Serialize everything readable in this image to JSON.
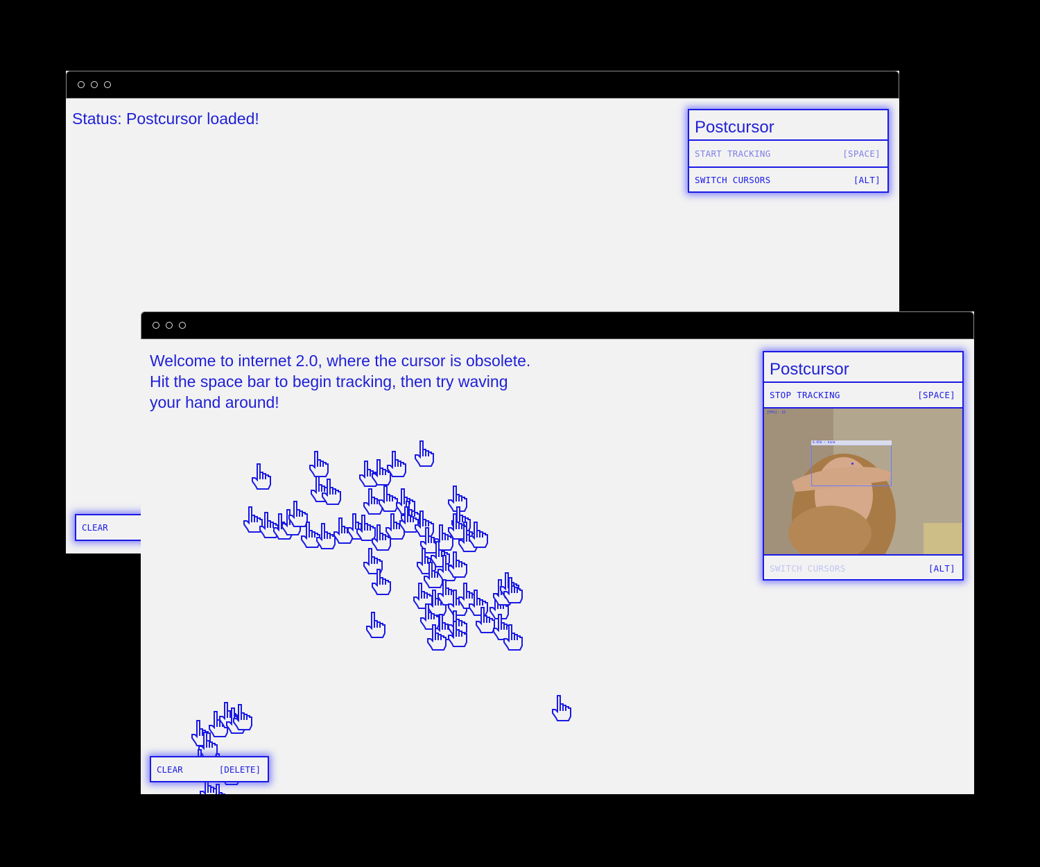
{
  "colors": {
    "accent": "#1a1ae6",
    "background": "#000000",
    "window": "#f2f2f2"
  },
  "back_window": {
    "status_text": "Status: Postcursor loaded!",
    "panel": {
      "title": "Postcursor",
      "rows": [
        {
          "label": "START TRACKING",
          "key": "[SPACE]"
        },
        {
          "label": "SWITCH CURSORS",
          "key": "[ALT]"
        }
      ]
    },
    "clear_button": {
      "label": "CLEAR"
    }
  },
  "front_window": {
    "intro_lines": [
      "Welcome to internet 2.0, where the cursor is obsolete.",
      "Hit the space bar to begin tracking, then try waving",
      "your hand around!"
    ],
    "panel": {
      "title": "Postcursor",
      "stop_row": {
        "label": "STOP TRACKING",
        "key": "[SPACE]"
      },
      "camera": {
        "fps_label": "[FPS]: 15",
        "detection_label": "0.856 : hand"
      },
      "switch_row": {
        "label": "SWITCH CURSORS",
        "key": "[ALT]"
      }
    },
    "clear_button": {
      "label": "CLEAR",
      "key": "[DELETE]"
    },
    "cursor_icon": "hand-pointer-icon"
  }
}
